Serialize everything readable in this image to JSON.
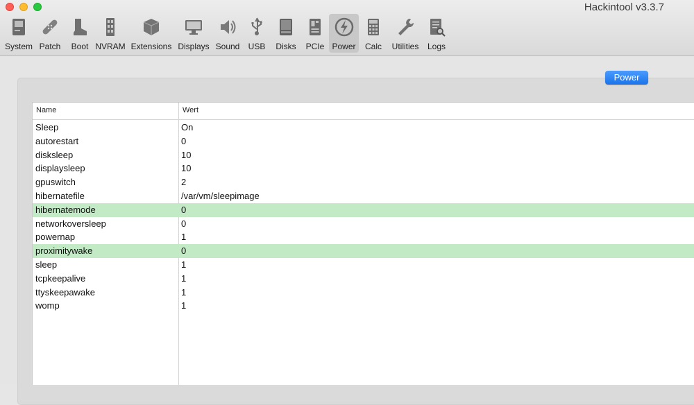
{
  "window": {
    "title": "Hackintool v3.3.7"
  },
  "toolbar": {
    "items": [
      {
        "label": "System",
        "icon": "system-icon"
      },
      {
        "label": "Patch",
        "icon": "patch-icon"
      },
      {
        "label": "Boot",
        "icon": "boot-icon"
      },
      {
        "label": "NVRAM",
        "icon": "nvram-icon"
      },
      {
        "label": "Extensions",
        "icon": "extensions-icon"
      },
      {
        "label": "Displays",
        "icon": "displays-icon"
      },
      {
        "label": "Sound",
        "icon": "sound-icon"
      },
      {
        "label": "USB",
        "icon": "usb-icon"
      },
      {
        "label": "Disks",
        "icon": "disks-icon"
      },
      {
        "label": "PCIe",
        "icon": "pcie-icon"
      },
      {
        "label": "Power",
        "icon": "power-icon",
        "selected": true
      },
      {
        "label": "Calc",
        "icon": "calc-icon"
      },
      {
        "label": "Utilities",
        "icon": "utilities-icon"
      },
      {
        "label": "Logs",
        "icon": "logs-icon"
      }
    ]
  },
  "main": {
    "segment_button": "Power",
    "table": {
      "columns": [
        "Name",
        "Wert"
      ],
      "rows": [
        {
          "name": "Sleep",
          "value": "On",
          "highlight": false
        },
        {
          "name": "autorestart",
          "value": "0",
          "highlight": false
        },
        {
          "name": "disksleep",
          "value": "10",
          "highlight": false
        },
        {
          "name": "displaysleep",
          "value": "10",
          "highlight": false
        },
        {
          "name": "gpuswitch",
          "value": "2",
          "highlight": false
        },
        {
          "name": "hibernatefile",
          "value": "/var/vm/sleepimage",
          "highlight": false
        },
        {
          "name": "hibernatemode",
          "value": "0",
          "highlight": true
        },
        {
          "name": "networkoversleep",
          "value": "0",
          "highlight": false
        },
        {
          "name": "powernap",
          "value": "1",
          "highlight": false
        },
        {
          "name": "proximitywake",
          "value": "0",
          "highlight": true
        },
        {
          "name": "sleep",
          "value": "1",
          "highlight": false
        },
        {
          "name": "tcpkeepalive",
          "value": "1",
          "highlight": false
        },
        {
          "name": "ttyskeepawake",
          "value": "1",
          "highlight": false
        },
        {
          "name": "womp",
          "value": "1",
          "highlight": false
        }
      ]
    }
  },
  "colors": {
    "highlight_row": "#c2ebc5",
    "accent_button": "#1a73e8"
  }
}
